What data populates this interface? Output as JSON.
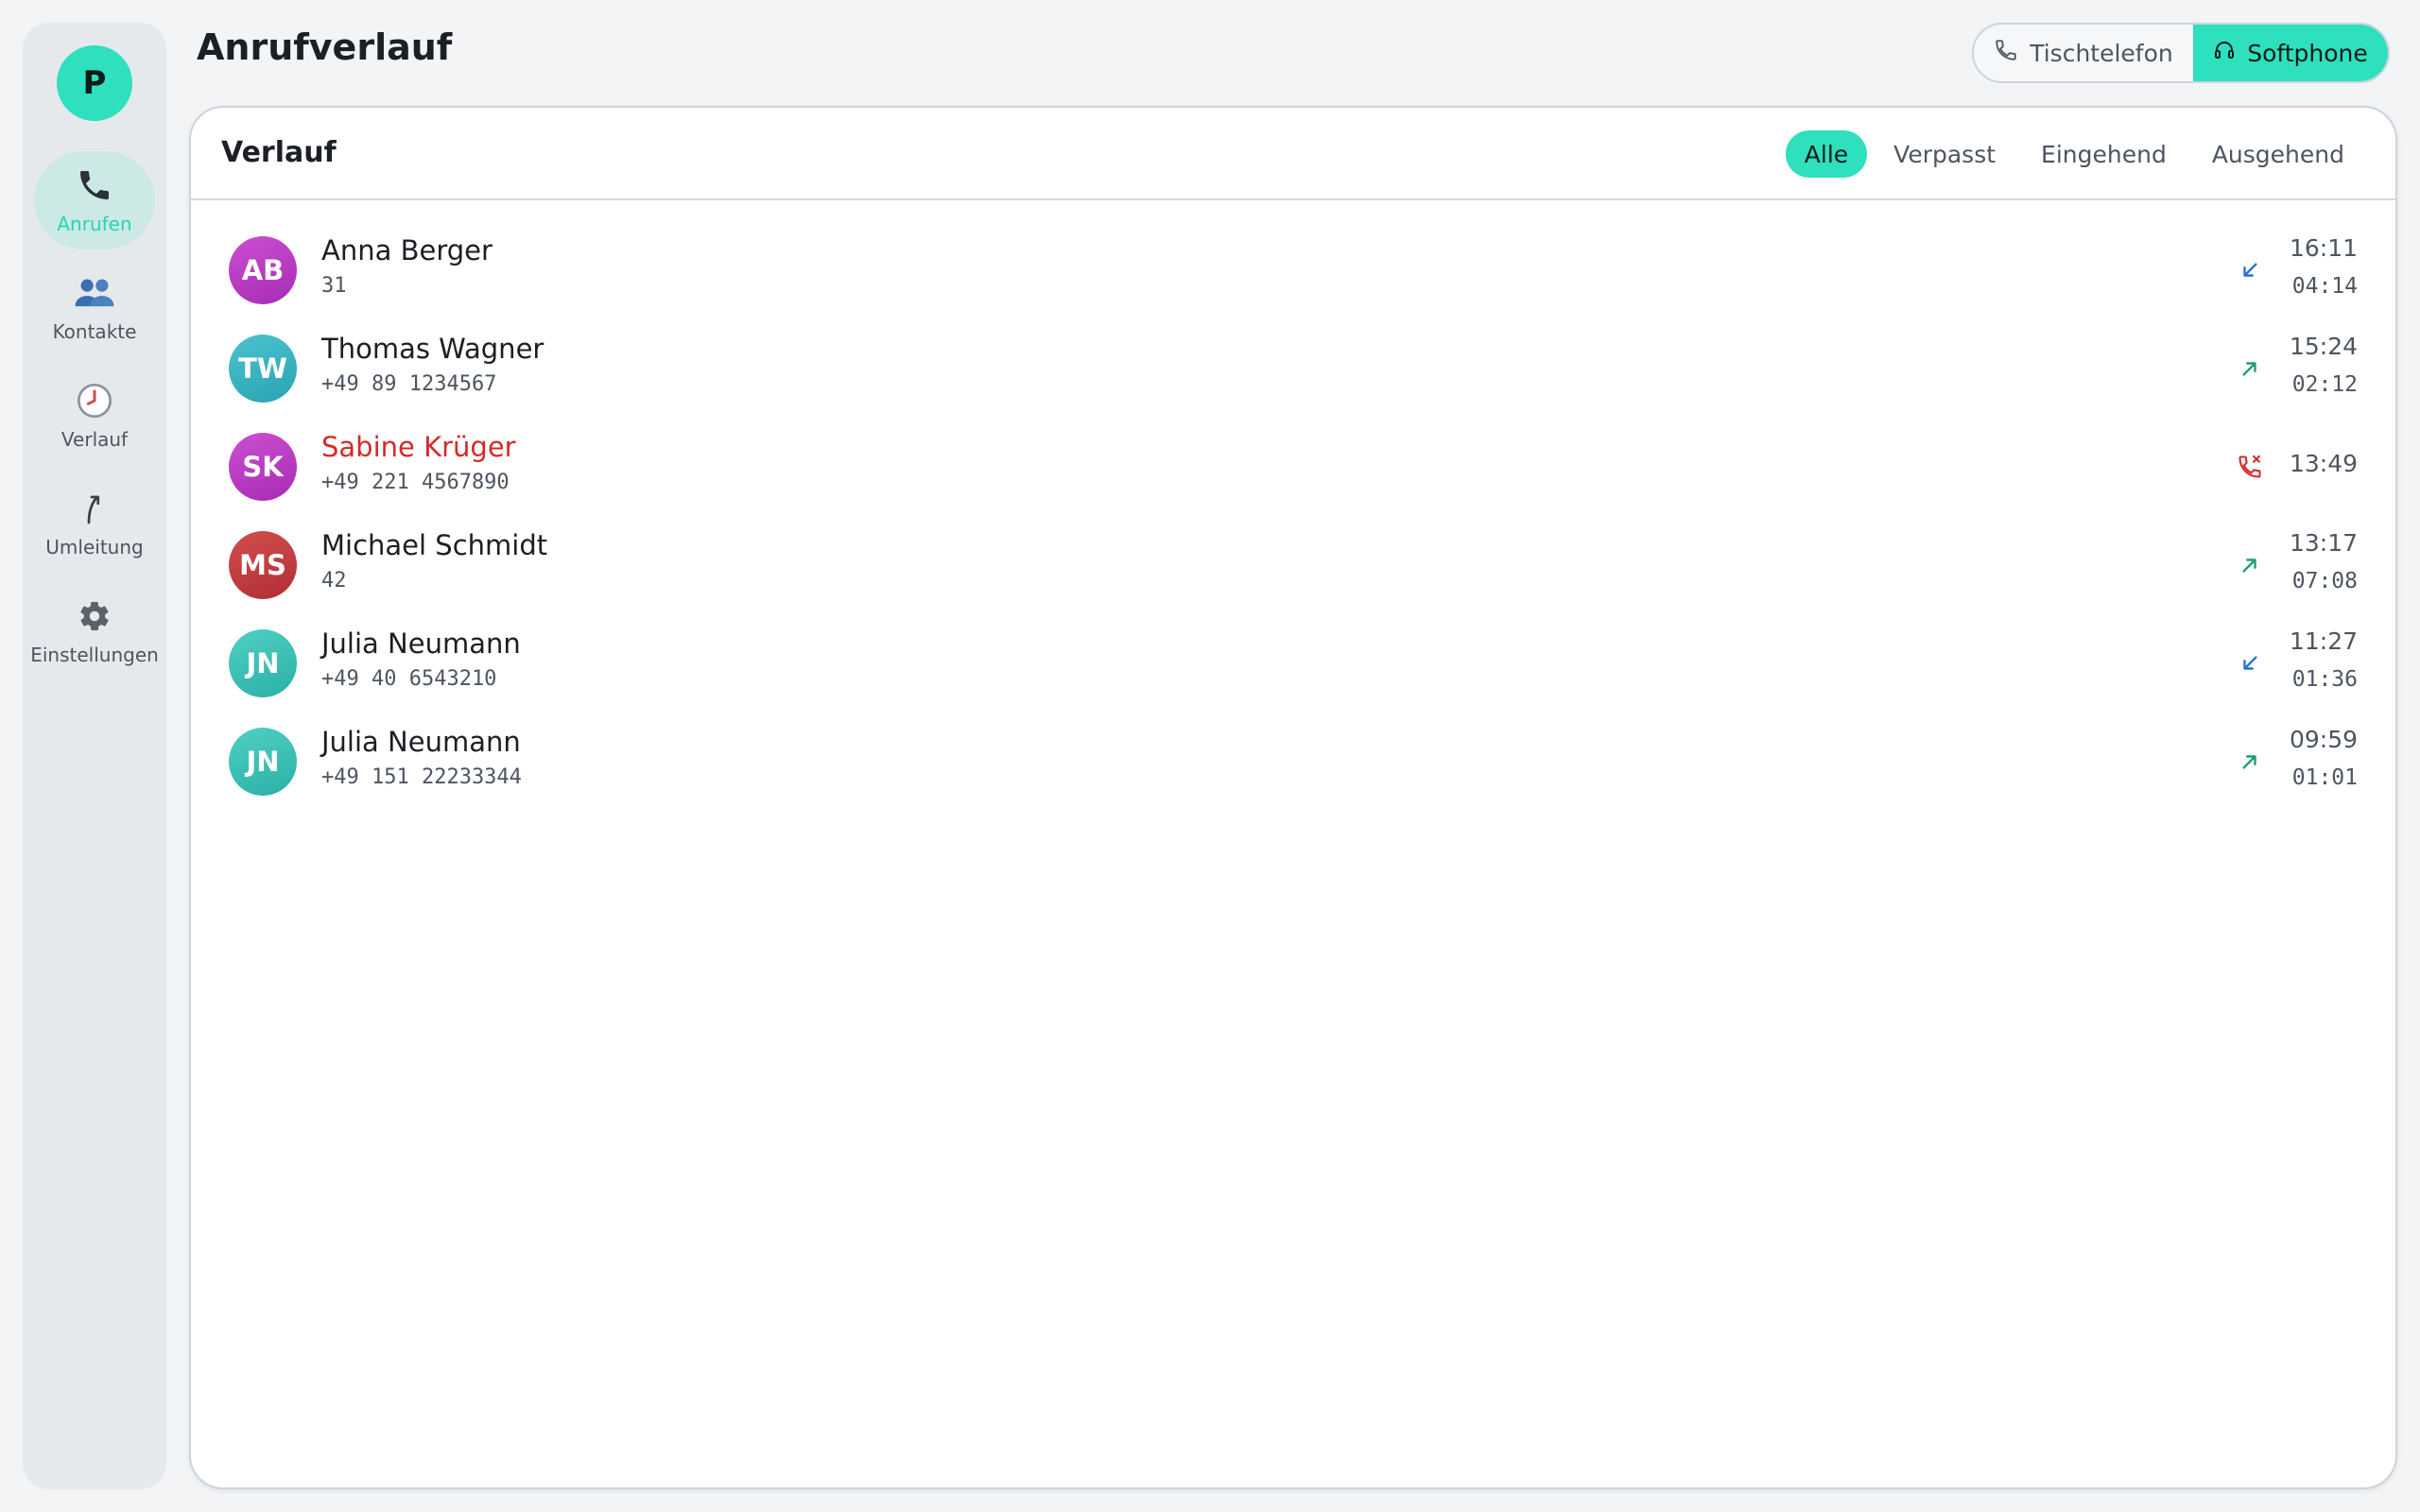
{
  "sidebar": {
    "profile_initial": "P",
    "items": [
      {
        "label": "Anrufen",
        "icon": "phone-icon"
      },
      {
        "label": "Kontakte",
        "icon": "contacts-icon"
      },
      {
        "label": "Verlauf",
        "icon": "clock-icon"
      },
      {
        "label": "Umleitung",
        "icon": "forward-icon"
      },
      {
        "label": "Einstellungen",
        "icon": "gear-icon"
      }
    ]
  },
  "header": {
    "title": "Anrufverlauf",
    "devices": {
      "desk_label": "Tischtelefon",
      "soft_label": "Softphone"
    }
  },
  "panel": {
    "title": "Verlauf",
    "filters": [
      "Alle",
      "Verpasst",
      "Eingehend",
      "Ausgehend"
    ],
    "calls": [
      {
        "initials": "AB",
        "name": "Anna Berger",
        "number": "31",
        "direction": "incoming",
        "time": "16:11",
        "duration": "04:14",
        "color_a": "#cc4fd0",
        "color_b": "#a62cb5"
      },
      {
        "initials": "TW",
        "name": "Thomas Wagner",
        "number": "+49 89 1234567",
        "direction": "outgoing",
        "time": "15:24",
        "duration": "02:12",
        "color_a": "#4cc3cf",
        "color_b": "#2aa3b2"
      },
      {
        "initials": "SK",
        "name": "Sabine Krüger",
        "number": "+49 221 4567890",
        "direction": "missed",
        "time": "13:49",
        "duration": "",
        "color_a": "#cc4fd0",
        "color_b": "#a62cb5"
      },
      {
        "initials": "MS",
        "name": "Michael Schmidt",
        "number": "42",
        "direction": "outgoing",
        "time": "13:17",
        "duration": "07:08",
        "color_a": "#d24e4e",
        "color_b": "#b02f35"
      },
      {
        "initials": "JN",
        "name": "Julia Neumann",
        "number": "+49 40 6543210",
        "direction": "incoming",
        "time": "11:27",
        "duration": "01:36",
        "color_a": "#4fd0c2",
        "color_b": "#2cb0a6"
      },
      {
        "initials": "JN",
        "name": "Julia Neumann",
        "number": "+49 151 22233344",
        "direction": "outgoing",
        "time": "09:59",
        "duration": "01:01",
        "color_a": "#4fd0c2",
        "color_b": "#2cb0a6"
      }
    ]
  },
  "colors": {
    "accent": "#2ee0bd",
    "incoming": "#2b6fd8",
    "outgoing": "#1f9e6a",
    "missed": "#d62a2a"
  }
}
